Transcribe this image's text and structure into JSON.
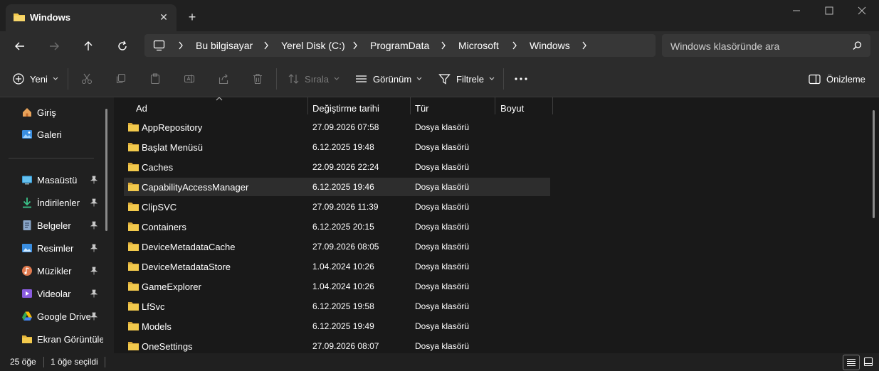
{
  "tab": {
    "title": "Windows"
  },
  "breadcrumb": [
    "Bu bilgisayar",
    "Yerel Disk (C:)",
    "ProgramData",
    "Microsoft",
    "Windows"
  ],
  "search": {
    "placeholder": "Windows klasöründe ara"
  },
  "toolbar": {
    "new_label": "Yeni",
    "sort_label": "Sırala",
    "view_label": "Görünüm",
    "filter_label": "Filtrele",
    "preview_label": "Önizleme"
  },
  "sidebar": {
    "top": [
      {
        "label": "Giriş",
        "icon": "home-icon"
      },
      {
        "label": "Galeri",
        "icon": "gallery-icon"
      }
    ],
    "pinned": [
      {
        "label": "Masaüstü",
        "icon": "desktop-icon",
        "color": "#3b9ed8"
      },
      {
        "label": "İndirilenler",
        "icon": "download-icon",
        "color": "#3bc48a"
      },
      {
        "label": "Belgeler",
        "icon": "documents-icon",
        "color": "#8aa6c8"
      },
      {
        "label": "Resimler",
        "icon": "pictures-icon",
        "color": "#3a8ee0"
      },
      {
        "label": "Müzikler",
        "icon": "music-icon",
        "color": "#e07a4f"
      },
      {
        "label": "Videolar",
        "icon": "videos-icon",
        "color": "#8a5ce0"
      },
      {
        "label": "Google Drive",
        "icon": "google-drive-icon",
        "color": "#34a853"
      },
      {
        "label": "Ekran Görüntüle",
        "icon": "folder-icon",
        "color": "#f2c94c"
      }
    ]
  },
  "columns": {
    "name": "Ad",
    "modified": "Değiştirme tarihi",
    "type": "Tür",
    "size": "Boyut"
  },
  "files": [
    {
      "name": "AppRepository",
      "modified": "27.09.2026 07:58",
      "type": "Dosya klasörü"
    },
    {
      "name": "Başlat Menüsü",
      "modified": "6.12.2025 19:48",
      "type": "Dosya klasörü"
    },
    {
      "name": "Caches",
      "modified": "22.09.2026 22:24",
      "type": "Dosya klasörü"
    },
    {
      "name": "CapabilityAccessManager",
      "modified": "6.12.2025 19:46",
      "type": "Dosya klasörü"
    },
    {
      "name": "ClipSVC",
      "modified": "27.09.2026 11:39",
      "type": "Dosya klasörü"
    },
    {
      "name": "Containers",
      "modified": "6.12.2025 20:15",
      "type": "Dosya klasörü"
    },
    {
      "name": "DeviceMetadataCache",
      "modified": "27.09.2026 08:05",
      "type": "Dosya klasörü"
    },
    {
      "name": "DeviceMetadataStore",
      "modified": "1.04.2024 10:26",
      "type": "Dosya klasörü"
    },
    {
      "name": "GameExplorer",
      "modified": "1.04.2024 10:26",
      "type": "Dosya klasörü"
    },
    {
      "name": "LfSvc",
      "modified": "6.12.2025 19:58",
      "type": "Dosya klasörü"
    },
    {
      "name": "Models",
      "modified": "6.12.2025 19:49",
      "type": "Dosya klasörü"
    },
    {
      "name": "OneSettings",
      "modified": "27.09.2026 08:07",
      "type": "Dosya klasörü"
    }
  ],
  "status": {
    "count": "25 öğe",
    "selected": "1 öğe seçildi"
  },
  "colors": {
    "folder": "#f2c94c",
    "background": "#191919",
    "chrome": "#2c2c2c"
  }
}
